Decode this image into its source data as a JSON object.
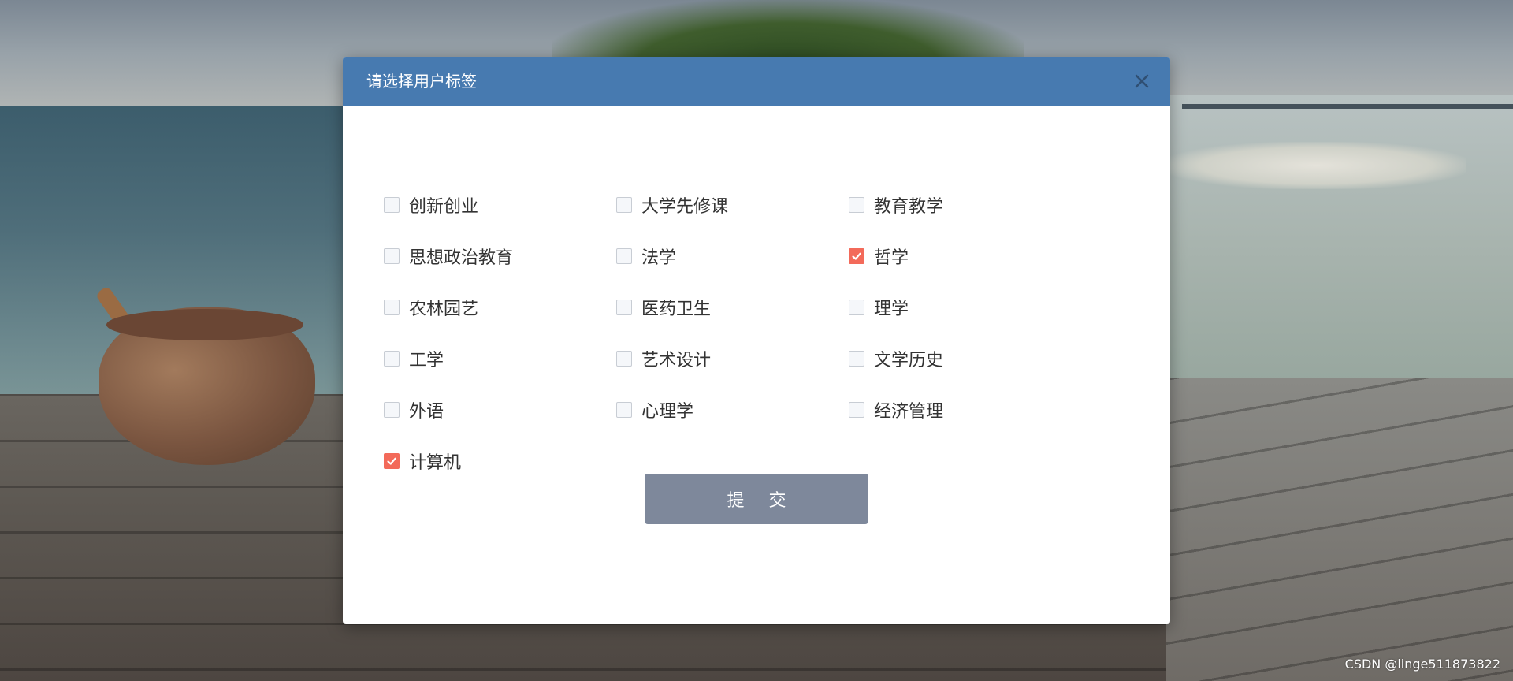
{
  "modal": {
    "title": "请选择用户标签",
    "submit_label": "提 交"
  },
  "tags": [
    {
      "label": "创新创业",
      "checked": false
    },
    {
      "label": "大学先修课",
      "checked": false
    },
    {
      "label": "教育教学",
      "checked": false
    },
    {
      "label": "思想政治教育",
      "checked": false
    },
    {
      "label": "法学",
      "checked": false
    },
    {
      "label": "哲学",
      "checked": true
    },
    {
      "label": "农林园艺",
      "checked": false
    },
    {
      "label": "医药卫生",
      "checked": false
    },
    {
      "label": "理学",
      "checked": false
    },
    {
      "label": "工学",
      "checked": false
    },
    {
      "label": "艺术设计",
      "checked": false
    },
    {
      "label": "文学历史",
      "checked": false
    },
    {
      "label": "外语",
      "checked": false
    },
    {
      "label": "心理学",
      "checked": false
    },
    {
      "label": "经济管理",
      "checked": false
    },
    {
      "label": "计算机",
      "checked": true
    }
  ],
  "watermark": "CSDN @linge511873822",
  "colors": {
    "header": "#477ab0",
    "checked": "#f36a5a",
    "submit": "#7e889b"
  }
}
